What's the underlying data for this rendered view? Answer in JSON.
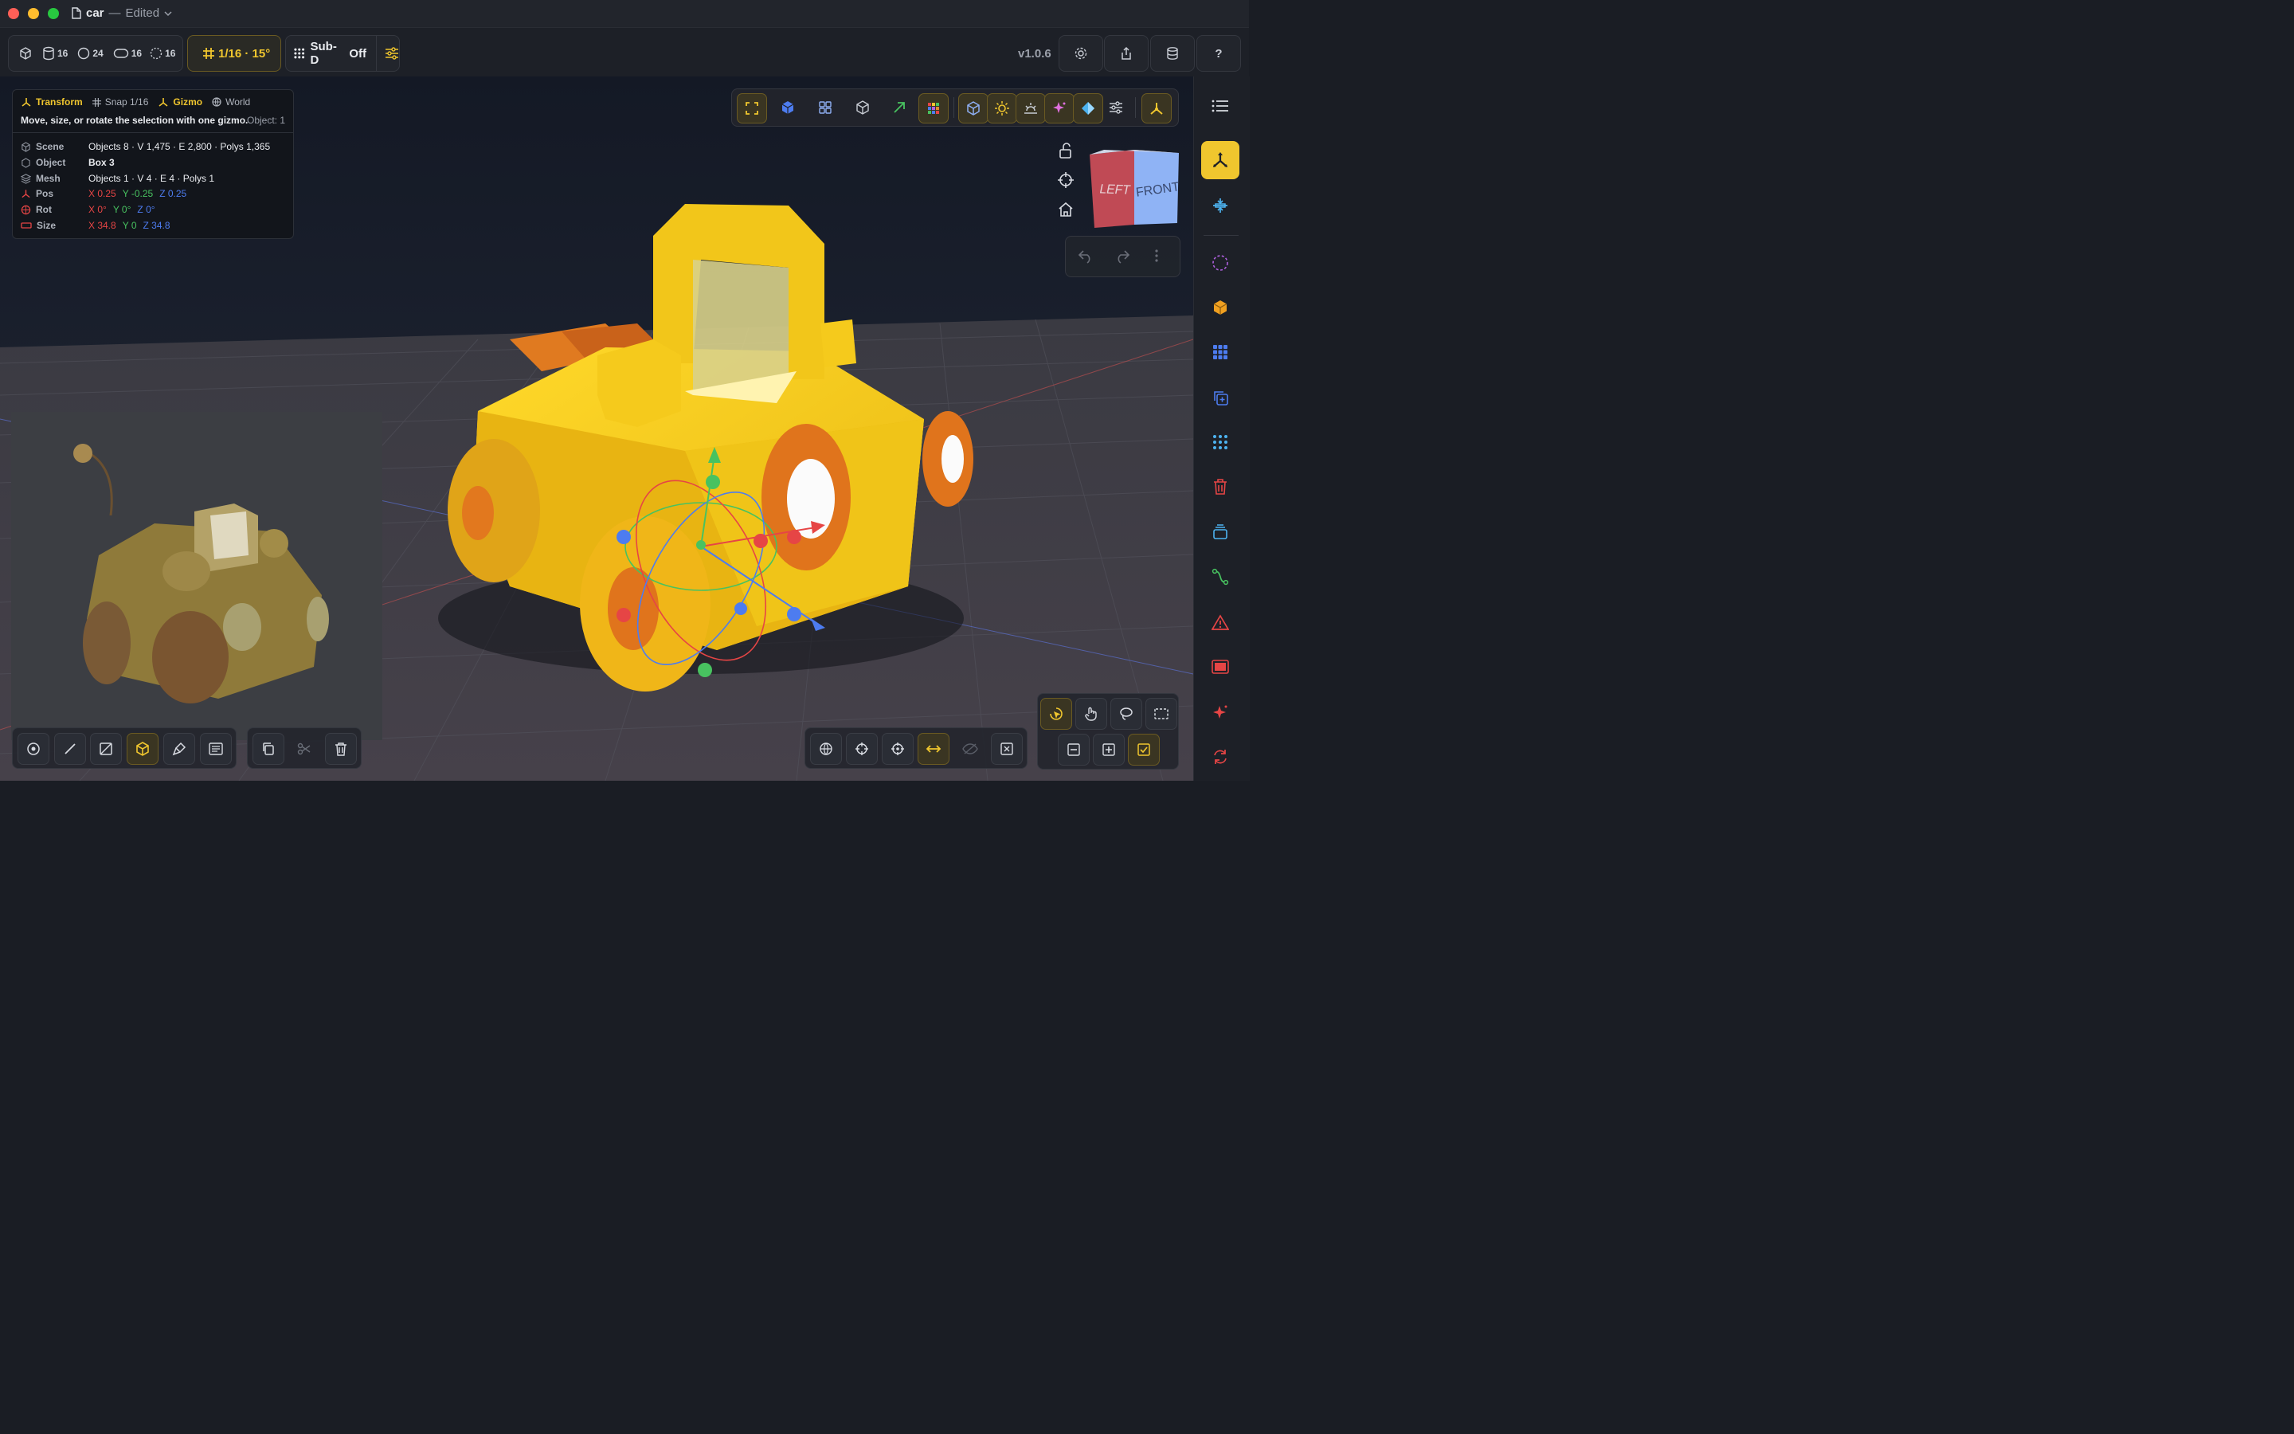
{
  "window": {
    "doc_name": "car",
    "dash": "—",
    "state": "Edited",
    "traffic_colors": [
      "#ff5f57",
      "#febc2e",
      "#28c840"
    ]
  },
  "toolbar": {
    "counts": [
      "16",
      "24",
      "16",
      "16"
    ],
    "snap_label": "1/16 · 15°",
    "subd_label": "Sub-D",
    "subd_state": "Off",
    "version": "v1.0.6"
  },
  "info": {
    "mode": "Transform",
    "snap": "Snap 1/16",
    "gizmo": "Gizmo",
    "space": "World",
    "hint": "Move, size, or rotate the selection with one gizmo.",
    "selection_count": "Object: 1",
    "scene_label": "Scene",
    "scene_value": "Objects 8 · V 1,475 · E 2,800 · Polys 1,365",
    "object_label": "Object",
    "object_value": "Box 3",
    "mesh_label": "Mesh",
    "mesh_value": "Objects 1 · V 4 · E 4 · Polys 1",
    "pos_label": "Pos",
    "pos": {
      "x": "X 0.25",
      "y": "Y -0.25",
      "z": "Z 0.25"
    },
    "rot_label": "Rot",
    "rot": {
      "x": "X 0°",
      "y": "Y 0°",
      "z": "Z 0°"
    },
    "size_label": "Size",
    "size": {
      "x": "X 34.8",
      "y": "Y 0",
      "z": "Z 34.8"
    }
  },
  "viewcube": {
    "left": "LEFT",
    "front": "FRONT"
  },
  "colors": {
    "accent": "#f0c62e",
    "x_axis": "#e64545",
    "y_axis": "#48c260",
    "z_axis": "#4d7cf0",
    "car_body": "#f2c418",
    "car_orange": "#e0741c"
  }
}
